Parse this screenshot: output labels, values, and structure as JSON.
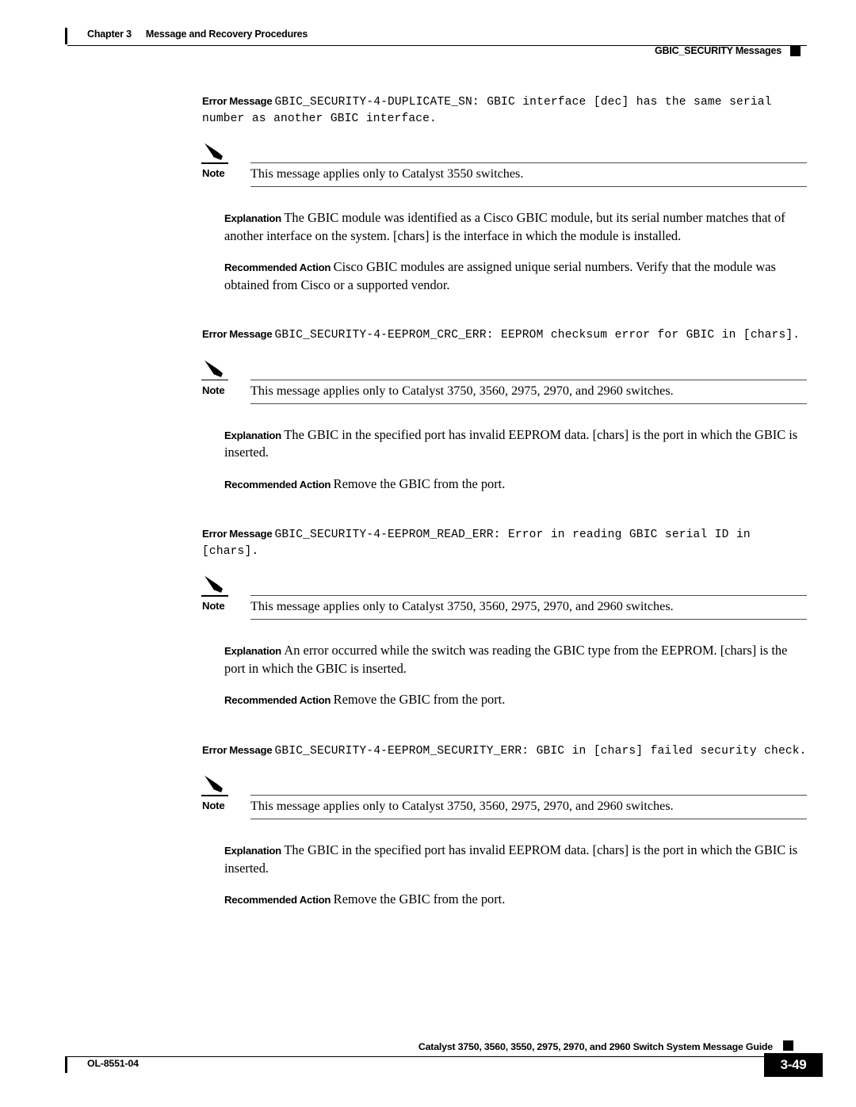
{
  "header": {
    "chapter_label": "Chapter 3",
    "chapter_title": "Message and Recovery Procedures",
    "section_title": "GBIC_SECURITY Messages"
  },
  "labels": {
    "error_message": "Error Message",
    "note": "Note",
    "explanation": "Explanation",
    "recommended_action": "Recommended Action"
  },
  "blocks": [
    {
      "error_message": "GBIC_SECURITY-4-DUPLICATE_SN: GBIC interface [dec] has the same serial number as another GBIC interface.",
      "note": "This message applies only to Catalyst 3550 switches.",
      "explanation": "The GBIC module was identified as a Cisco GBIC module, but its serial number matches that of another interface on the system. [chars] is the interface in which the module is installed.",
      "recommended_action": "Cisco GBIC modules are assigned unique serial numbers. Verify that the module was obtained from Cisco or a supported vendor."
    },
    {
      "error_message": "GBIC_SECURITY-4-EEPROM_CRC_ERR: EEPROM checksum error for GBIC in [chars].",
      "note": "This message applies only to Catalyst 3750, 3560, 2975, 2970, and 2960 switches.",
      "explanation": "The GBIC in the specified port has invalid EEPROM data. [chars] is the port in which the GBIC is inserted.",
      "recommended_action": "Remove the GBIC from the port."
    },
    {
      "error_message": "GBIC_SECURITY-4-EEPROM_READ_ERR: Error in reading GBIC serial ID in [chars].",
      "note": "This message applies only to Catalyst 3750, 3560, 2975, 2970, and 2960 switches.",
      "explanation": "An error occurred while the switch was reading the GBIC type from the EEPROM. [chars] is the port in which the GBIC is inserted.",
      "recommended_action": "Remove the GBIC from the port."
    },
    {
      "error_message": "GBIC_SECURITY-4-EEPROM_SECURITY_ERR: GBIC in [chars] failed security check.",
      "note": "This message applies only to Catalyst 3750, 3560, 2975, 2970, and 2960 switches.",
      "explanation": "The GBIC in the specified port has invalid EEPROM data. [chars] is the port in which the GBIC is inserted.",
      "recommended_action": "Remove the GBIC from the port."
    }
  ],
  "footer": {
    "guide_title": "Catalyst 3750, 3560, 3550, 2975, 2970, and 2960 Switch System Message Guide",
    "doc_id": "OL-8551-04",
    "page_number": "3-49"
  },
  "colors": {
    "text": "#000000",
    "rule": "#000000",
    "note_rule": "#4d4d4d",
    "page_background": "#ffffff"
  }
}
